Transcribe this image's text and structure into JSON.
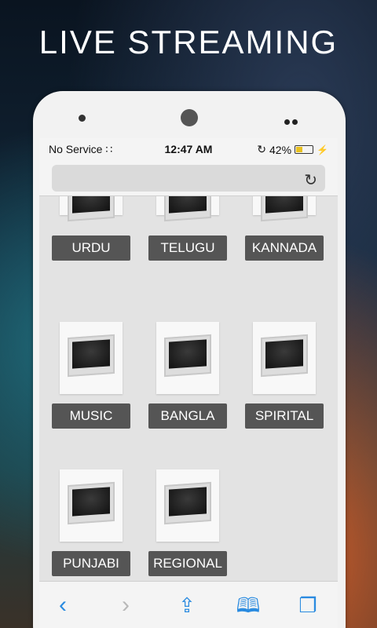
{
  "headline": "LIVE STREAMING",
  "status": {
    "carrier": "No Service",
    "time": "12:47 AM",
    "battery": "42%",
    "battery_level": 0.42
  },
  "channels": [
    {
      "label": "URDU"
    },
    {
      "label": "TELUGU"
    },
    {
      "label": "KANNADA"
    },
    {
      "label": "MUSIC"
    },
    {
      "label": "BANGLA"
    },
    {
      "label": "SPIRITAL"
    },
    {
      "label": "PUNJABI"
    },
    {
      "label": "REGIONAL"
    }
  ],
  "toolbar": {
    "back_icon": "chevron-left-icon",
    "forward_icon": "chevron-right-icon",
    "share_icon": "share-icon",
    "bookmarks_icon": "bookmarks-icon",
    "tabs_icon": "tabs-icon"
  },
  "colors": {
    "label_bg": "#555555",
    "accent": "#2a8be0",
    "battery": "#e8c020"
  }
}
